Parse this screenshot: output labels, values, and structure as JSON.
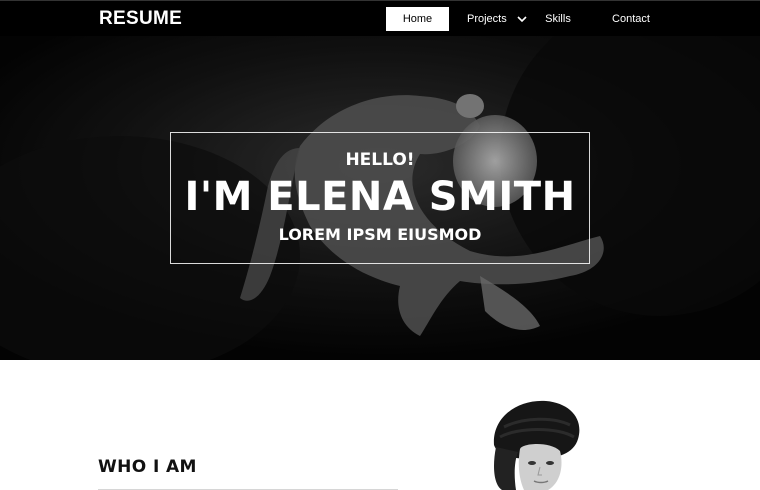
{
  "navbar": {
    "brand": "RESUME",
    "items": [
      {
        "label": "Home",
        "active": true
      },
      {
        "label": "Projects",
        "has_dropdown": true
      },
      {
        "label": "Skills"
      },
      {
        "label": "Contact"
      }
    ]
  },
  "hero": {
    "greeting": "HELLO!",
    "name": "I'M ELENA SMITH",
    "subtitle": "LOREM IPSM EIUSMOD"
  },
  "about": {
    "heading": "WHO I AM"
  },
  "colors": {
    "navbar_bg": "#000000",
    "hero_bg": "#050505",
    "text_light": "#ffffff",
    "text_dark": "#111111"
  },
  "icons": [
    "chevron-down-icon"
  ]
}
